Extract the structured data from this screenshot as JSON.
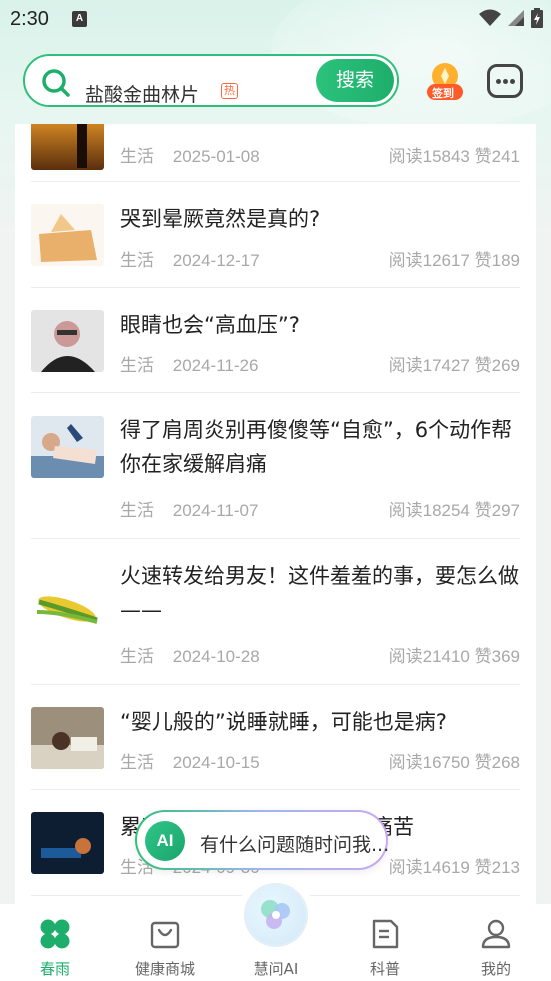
{
  "status_bar": {
    "time": "2:30",
    "notification_letter": "A"
  },
  "header": {
    "search_text": "盐酸金曲林片",
    "hot_badge": "热",
    "search_button": "搜索",
    "checkin_label": "签到"
  },
  "articles": [
    {
      "title": "",
      "category": "生活",
      "date": "2025-01-08",
      "reads": "阅读15843",
      "likes": "赞241"
    },
    {
      "title": "哭到晕厥竟然是真的?",
      "category": "生活",
      "date": "2024-12-17",
      "reads": "阅读12617",
      "likes": "赞189"
    },
    {
      "title": "眼睛也会“高血压”?",
      "category": "生活",
      "date": "2024-11-26",
      "reads": "阅读17427",
      "likes": "赞269"
    },
    {
      "title": "得了肩周炎别再傻傻等“自愈”，6个动作帮你在家缓解肩痛",
      "category": "生活",
      "date": "2024-11-07",
      "reads": "阅读18254",
      "likes": "赞297"
    },
    {
      "title": "火速转发给男友！这件羞羞的事，要怎么做——",
      "category": "生活",
      "date": "2024-10-28",
      "reads": "阅读21410",
      "likes": "赞369"
    },
    {
      "title": "“婴儿般的”说睡就睡，可能也是病?",
      "category": "生活",
      "date": "2024-10-15",
      "reads": "阅读16750",
      "likes": "赞268"
    },
    {
      "title": "累了嗎，为啥调休这么让人痛苦",
      "category": "生活",
      "date": "2024-09-30",
      "reads": "阅读14619",
      "likes": "赞213"
    }
  ],
  "ai_bubble": {
    "logo": "AI",
    "text": "有什么问题随时问我..."
  },
  "bottom_nav": [
    {
      "label": "春雨",
      "icon": "clover-icon",
      "active": true
    },
    {
      "label": "健康商城",
      "icon": "shopping-bag-icon",
      "active": false
    },
    {
      "label": "慧问AI",
      "icon": "ai-orb-icon",
      "active": false
    },
    {
      "label": "科普",
      "icon": "document-icon",
      "active": false
    },
    {
      "label": "我的",
      "icon": "user-icon",
      "active": false
    }
  ],
  "colors": {
    "brand_green": "#1eae6c",
    "hot_orange": "#ff6a3d",
    "meta_gray": "#a8a8a8"
  }
}
